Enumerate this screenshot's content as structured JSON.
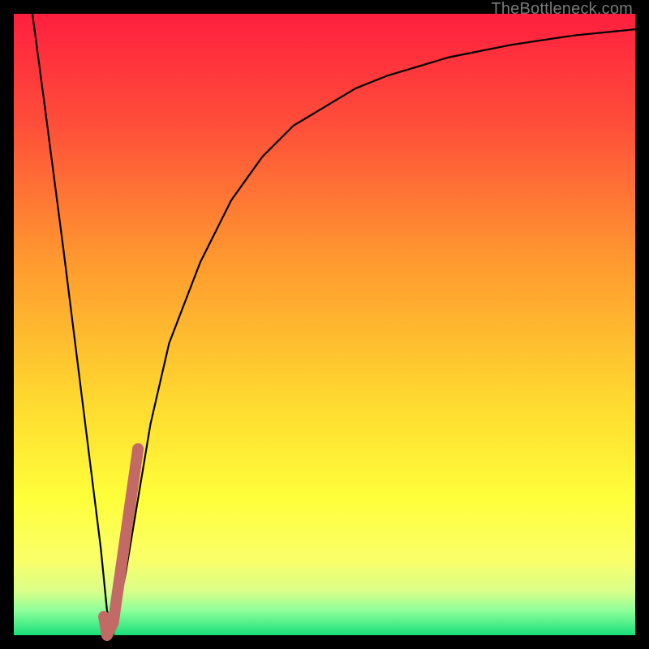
{
  "watermark": "TheBottleneck.com",
  "gradient_stops": [
    {
      "pct": 0,
      "color": "#ff1f3e"
    },
    {
      "pct": 18,
      "color": "#ff4f3a"
    },
    {
      "pct": 40,
      "color": "#ff9a2f"
    },
    {
      "pct": 62,
      "color": "#ffd82f"
    },
    {
      "pct": 78,
      "color": "#ffff3a"
    },
    {
      "pct": 88,
      "color": "#faff6a"
    },
    {
      "pct": 93,
      "color": "#d9ff8a"
    },
    {
      "pct": 96,
      "color": "#8fff9a"
    },
    {
      "pct": 100,
      "color": "#18e07a"
    }
  ],
  "highlight_color": "#c46a66",
  "curve_color": "#000000",
  "chart_data": {
    "type": "line",
    "title": "",
    "xlabel": "",
    "ylabel": "",
    "xlim": [
      0,
      100
    ],
    "ylim": [
      0,
      100
    ],
    "series": [
      {
        "name": "main-curve",
        "x": [
          3,
          5,
          8,
          10,
          12,
          14,
          15,
          16,
          18,
          20,
          22,
          25,
          30,
          35,
          40,
          45,
          50,
          55,
          60,
          70,
          80,
          90,
          100
        ],
        "y": [
          100,
          85,
          62,
          46,
          30,
          14,
          4,
          0,
          10,
          22,
          34,
          47,
          60,
          70,
          77,
          82,
          85,
          88,
          90,
          93,
          95,
          96.5,
          97.5
        ]
      },
      {
        "name": "highlight-segment",
        "x": [
          14.5,
          15,
          16,
          17,
          18,
          19,
          20
        ],
        "y": [
          3,
          0,
          2,
          9,
          16,
          23,
          30
        ]
      }
    ]
  }
}
